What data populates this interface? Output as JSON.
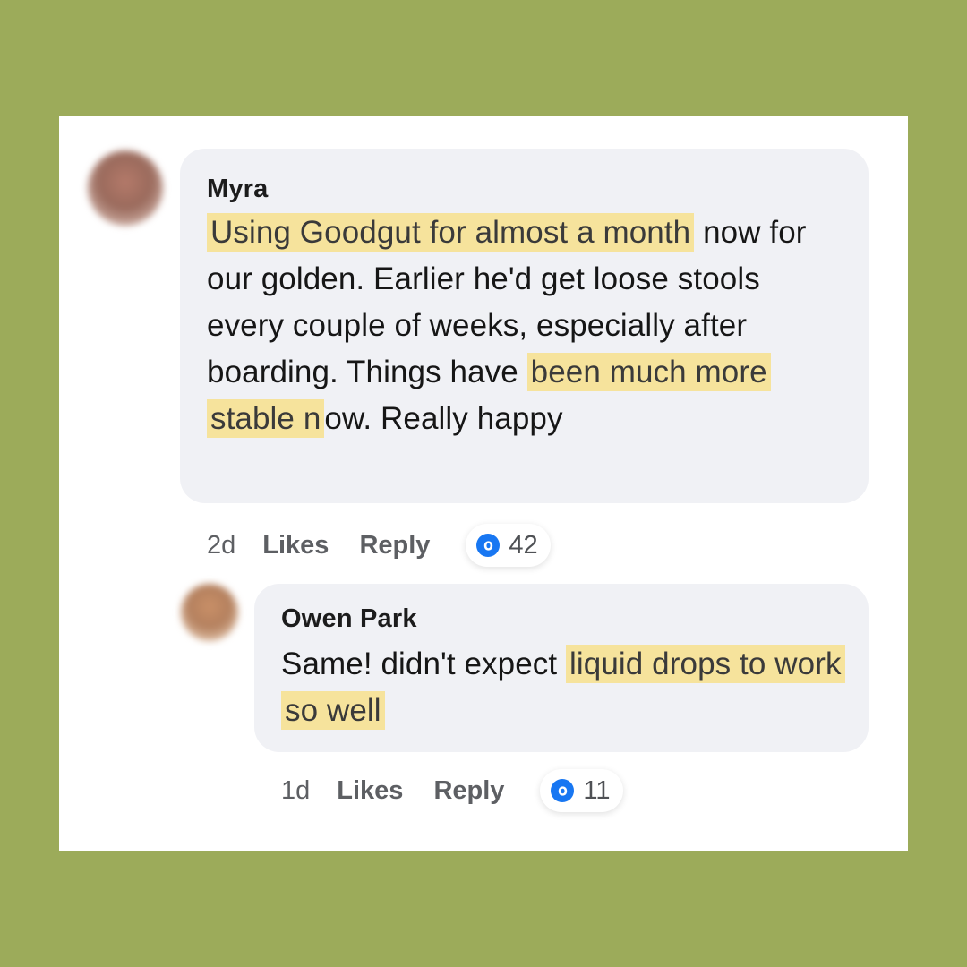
{
  "comments": [
    {
      "author": "Myra",
      "text_parts": [
        {
          "text": "Using Goodgut for almost a month",
          "highlight": true
        },
        {
          "text": " now for our golden. Earlier he'd get loose stools every couple of weeks, especially after boarding. Things have ",
          "highlight": false
        },
        {
          "text": "been much more stable n",
          "highlight": true
        },
        {
          "text": "ow. Really happy",
          "highlight": false
        }
      ],
      "time": "2d",
      "likes_label": "Likes",
      "reply_label": "Reply",
      "reaction_count": "42",
      "reaction_icon": "like-icon"
    },
    {
      "author": "Owen Park",
      "text_parts": [
        {
          "text": "Same! didn't expect ",
          "highlight": false
        },
        {
          "text": "liquid drops to work so well",
          "highlight": true
        }
      ],
      "time": "1d",
      "likes_label": "Likes",
      "reply_label": "Reply",
      "reaction_count": "11",
      "reaction_icon": "like-icon"
    }
  ],
  "colors": {
    "background": "#9cab5a",
    "bubble": "#f0f1f5",
    "highlight": "#f6e39c",
    "like_blue": "#1877f2"
  }
}
